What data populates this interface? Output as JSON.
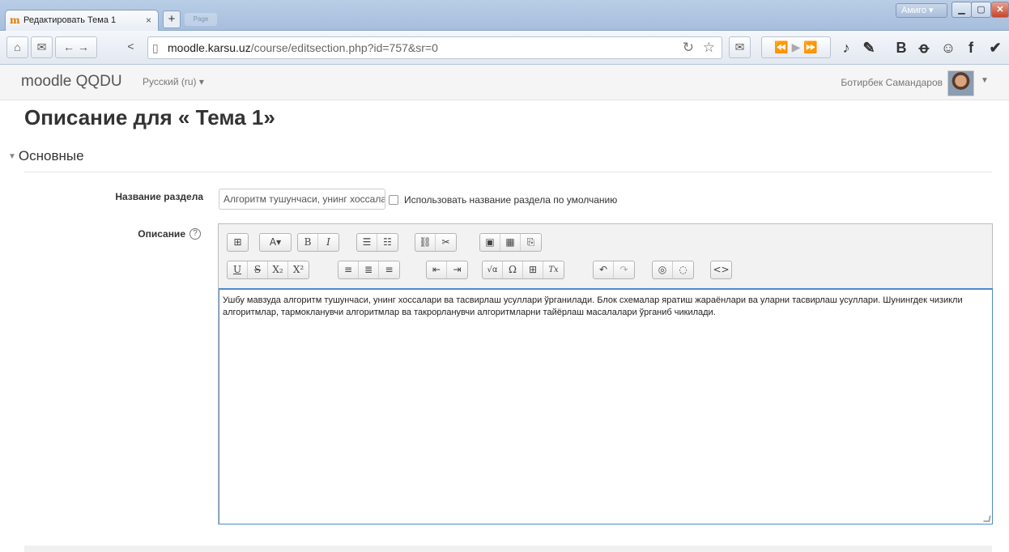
{
  "browser": {
    "tab_title": "Редактировать Тема 1",
    "tab_close": "×",
    "new_tab": "+",
    "background_tab": "Page",
    "user_button": "Амиго",
    "url_host": "moodle.karsu.uz",
    "url_path": "/course/editsection.php?id=757&sr=0"
  },
  "header": {
    "brand": "moodle QQDU",
    "language": "Русский (ru) ▾",
    "user_name": "Ботирбек Самандаров"
  },
  "page": {
    "title": "Описание для « Тема 1»",
    "section_heading": "Основные",
    "name_label": "Название раздела",
    "name_value": "Алгоритм тушунчаси, унинг хоссалари",
    "default_name_label": "Использовать название раздела по умолчанию",
    "description_label": "Описание",
    "help": "?"
  },
  "editor": {
    "toolbar_row1": [
      [
        "⊞"
      ],
      [
        "A▾"
      ],
      [
        "B",
        "I"
      ],
      [
        "☰",
        "☷"
      ],
      [
        "⛓",
        "✂"
      ],
      [
        "▣",
        "▦",
        "⎘"
      ]
    ],
    "toolbar_row2": [
      [
        "U",
        "S",
        "X₂",
        "X²"
      ],
      [
        "≡",
        "≣",
        "≡"
      ],
      [
        "⇤",
        "⇥"
      ],
      [
        "√α",
        "Ω",
        "⊞",
        "Tx"
      ],
      [
        "↶",
        "↷"
      ],
      [
        "◎",
        "◌"
      ],
      [
        "<>"
      ]
    ],
    "content": "Ушбу мавзуда алгоритм тушунчаси, унинг хоссалари ва тасвирлаш усуллари ўрганилади. Блок схемалар яратиш жараёнлари ва уларни тасвирлаш усуллари. Шунингдек чизикли алгоритмлар, тармокланувчи алгоритмлар ва такрорланувчи алгоритмларни тайёрлаш масалалари ўрганиб чикилади."
  }
}
